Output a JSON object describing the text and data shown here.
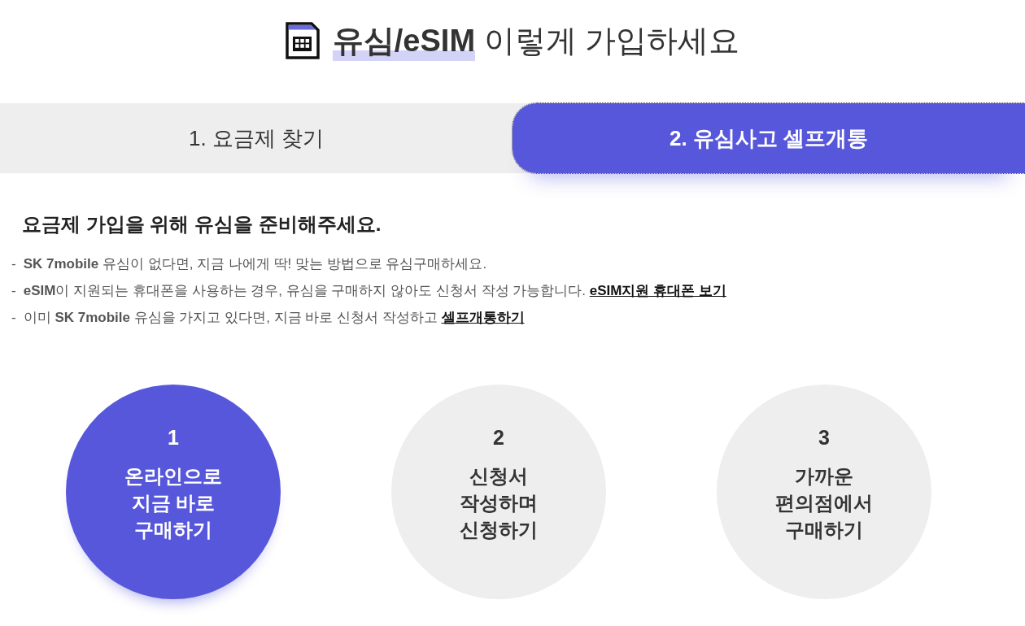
{
  "title": "**유심/eSIM** 이렇게 가입하세요",
  "tabs": [
    {
      "label": "1. 요금제 찾기",
      "selected": false
    },
    {
      "label": "2. 유심사고 셀프개통",
      "selected": true
    }
  ],
  "heading": "요금제 가입을 위해 유심을 준비해주세요.",
  "notes": [
    {
      "marker": "-",
      "text": "**SK 7mobile** 유심이 없다면, 지금 나에게 딱! 맞는 방법으로 유심구매하세요."
    },
    {
      "marker": "-",
      "text": "**eSIM**이 지원되는 휴대폰을 사용하는 경우, 유심을 구매하지 않아도 신청서 작성 가능합니다.",
      "link": "eSIM지원 휴대폰 보기"
    },
    {
      "marker": "-",
      "text": "이미 **SK 7mobile** 유심을 가지고 있다면, 지금 바로 신청서 작성하고",
      "link": "셀프개통하기"
    }
  ],
  "steps": [
    {
      "number": "1",
      "lines": [
        "온라인으로",
        "지금 바로",
        "구매하기"
      ],
      "selected": true
    },
    {
      "number": "2",
      "lines": [
        "신청서",
        "작성하며",
        "신청하기"
      ],
      "selected": false
    },
    {
      "number": "3",
      "lines": [
        "가까운",
        "편의점에서",
        "구매하기"
      ],
      "selected": false
    }
  ]
}
